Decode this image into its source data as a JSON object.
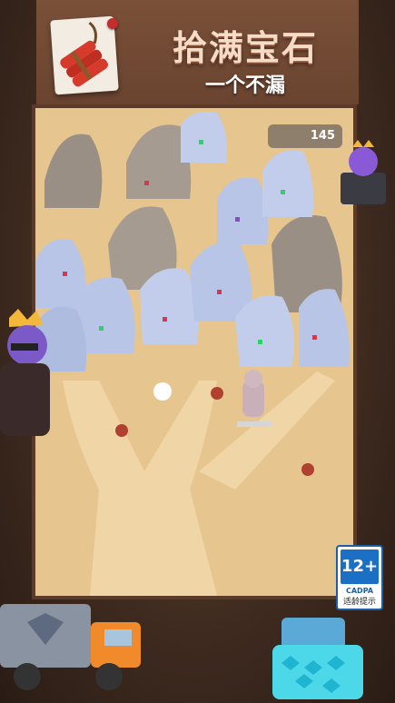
{
  "banner": {
    "title": "拾满宝石",
    "subtitle": "一个不漏"
  },
  "hud": {
    "score": "145"
  },
  "rating": {
    "age": "12+",
    "org": "CADPA",
    "tip": "适龄提示"
  },
  "colors": {
    "accent_sand": "#e7c58f",
    "rock_blue": "#b8c5e6",
    "rock_grey": "#9a8f84",
    "gem_red": "#e0324a",
    "gem_green": "#2fd06a"
  }
}
